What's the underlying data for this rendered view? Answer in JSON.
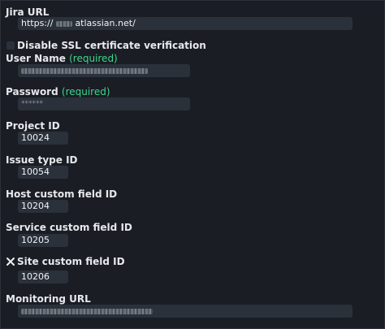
{
  "form": {
    "jira_url": {
      "label": "Jira URL",
      "prefix": "https://",
      "suffix": "atlassian.net/"
    },
    "disable_ssl": {
      "label": "Disable SSL certificate verification",
      "checked": false
    },
    "user_name": {
      "label": "User Name",
      "required": "(required)"
    },
    "password": {
      "label": "Password",
      "required": "(required)",
      "masked": "******"
    },
    "project_id": {
      "label": "Project ID",
      "value": "10024"
    },
    "issue_type_id": {
      "label": "Issue type ID",
      "value": "10054"
    },
    "host_custom_field_id": {
      "label": "Host custom field ID",
      "value": "10204"
    },
    "service_custom_field_id": {
      "label": "Service custom field ID",
      "value": "10205"
    },
    "site_custom_field_id": {
      "label": "Site custom field ID",
      "value": "10206",
      "checked": true
    },
    "monitoring_url": {
      "label": "Monitoring URL"
    }
  },
  "colors": {
    "background": "#1a1d24",
    "field": "#2b313a",
    "required": "#3dd68c"
  }
}
